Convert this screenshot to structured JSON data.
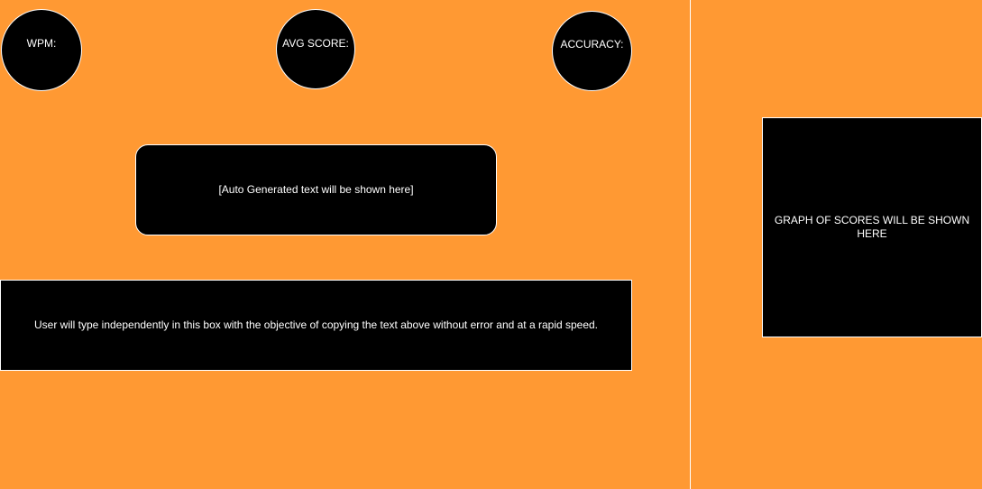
{
  "stats": {
    "wpm_label": "WPM:",
    "avg_score_label": "AVG SCORE:",
    "accuracy_label": "ACCURACY:"
  },
  "generated_text": {
    "placeholder": "[Auto Generated text will be shown here]"
  },
  "typing_area": {
    "placeholder": "User will type independently in this box with the objective of copying the text above without error and at a rapid speed."
  },
  "graph": {
    "placeholder": "GRAPH OF SCORES WILL BE SHOWN HERE"
  },
  "colors": {
    "background": "#FF9933",
    "panel": "#000000",
    "text": "#FFFFFF"
  }
}
